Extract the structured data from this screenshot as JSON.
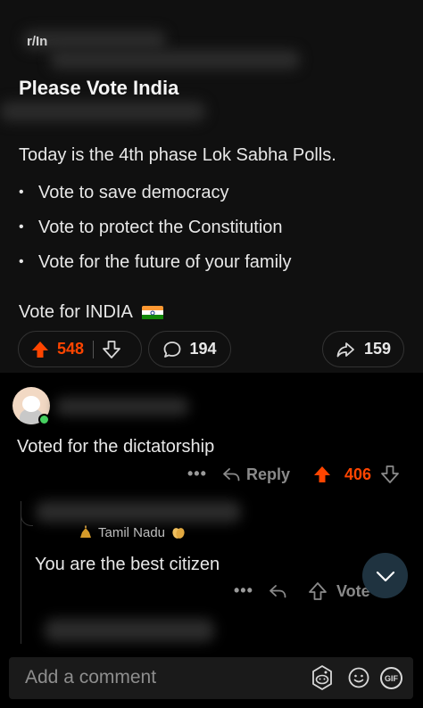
{
  "post": {
    "subreddit": "r/In",
    "title": "Please Vote India",
    "body": "Today is the 4th phase Lok Sabha Polls.",
    "bullets": [
      "Vote to save democracy",
      "Vote to protect the Constitution",
      "Vote for the future of your family"
    ],
    "closing": "Vote for INDIA",
    "upvotes": "548",
    "comments": "194",
    "shares": "159"
  },
  "comment1": {
    "text": "Voted for the dictatorship",
    "reply_label": "Reply",
    "score": "406",
    "more": "•••"
  },
  "comment2": {
    "flair": "Tamil Nadu",
    "text": "You are the best citizen",
    "vote_label": "Vote",
    "more": "•••"
  },
  "composer": {
    "placeholder": "Add a comment",
    "gif_label": "GIF"
  },
  "colors": {
    "upvote": "#ff4500",
    "background": "#101010",
    "online": "#46d160"
  },
  "icons": [
    "upvote-arrow-icon",
    "downvote-arrow-icon",
    "comment-bubble-icon",
    "share-arrow-icon",
    "reply-arrow-icon",
    "chevron-down-icon",
    "snoo-icon",
    "emoji-icon",
    "gif-icon",
    "flag-india-icon"
  ]
}
